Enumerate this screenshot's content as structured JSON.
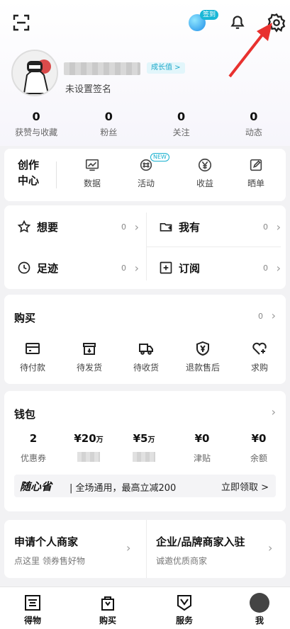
{
  "header": {
    "badge_label": "签到",
    "growth_label": "成长值 >",
    "signature": "未设置签名"
  },
  "stats": [
    {
      "value": "0",
      "label": "获赞与收藏"
    },
    {
      "value": "0",
      "label": "粉丝"
    },
    {
      "value": "0",
      "label": "关注"
    },
    {
      "value": "0",
      "label": "动态"
    }
  ],
  "creator": {
    "title": "创作中心",
    "items": [
      {
        "label": "数据",
        "icon": "chart-icon"
      },
      {
        "label": "活动",
        "icon": "activity-icon",
        "tag": "NEW"
      },
      {
        "label": "收益",
        "icon": "yen-icon"
      },
      {
        "label": "晒单",
        "icon": "edit-icon"
      }
    ]
  },
  "wants": [
    {
      "label": "想要",
      "count": "0",
      "icon": "star-icon"
    },
    {
      "label": "我有",
      "count": "0",
      "icon": "folder-plus-icon"
    },
    {
      "label": "足迹",
      "count": "0",
      "icon": "clock-icon"
    },
    {
      "label": "订阅",
      "count": "0",
      "icon": "plus-square-icon"
    }
  ],
  "buy": {
    "title": "购买",
    "count": "0",
    "items": [
      {
        "label": "待付款",
        "icon": "card-icon"
      },
      {
        "label": "待发货",
        "icon": "box-icon"
      },
      {
        "label": "待收货",
        "icon": "truck-icon"
      },
      {
        "label": "退款售后",
        "icon": "shield-yen-icon"
      },
      {
        "label": "求购",
        "icon": "heart-plus-icon"
      }
    ]
  },
  "wallet": {
    "title": "钱包",
    "cols": [
      {
        "value": "2",
        "unit": "",
        "label": "优惠券"
      },
      {
        "value": "¥20",
        "unit": "万",
        "label": ""
      },
      {
        "value": "¥5",
        "unit": "万",
        "label": ""
      },
      {
        "value": "¥0",
        "unit": "",
        "label": "津贴"
      },
      {
        "value": "¥0",
        "unit": "",
        "label": "余额"
      }
    ],
    "promo_logo": "随心省",
    "promo_text": "| 全场通用，最高立减200",
    "promo_cta": "立即领取 >"
  },
  "merchant": [
    {
      "title": "申请个人商家",
      "sub": "点这里 领券售好物"
    },
    {
      "title": "企业/品牌商家入驻",
      "sub": "诚邀优质商家"
    }
  ],
  "tabs": [
    {
      "label": "得物",
      "icon": "dewu-icon"
    },
    {
      "label": "购买",
      "icon": "bag-icon"
    },
    {
      "label": "服务",
      "icon": "service-icon"
    },
    {
      "label": "我",
      "icon": "avatar-icon"
    }
  ],
  "colors": {
    "accent": "#19b0cf",
    "highlight_arrow": "#e8312f"
  }
}
